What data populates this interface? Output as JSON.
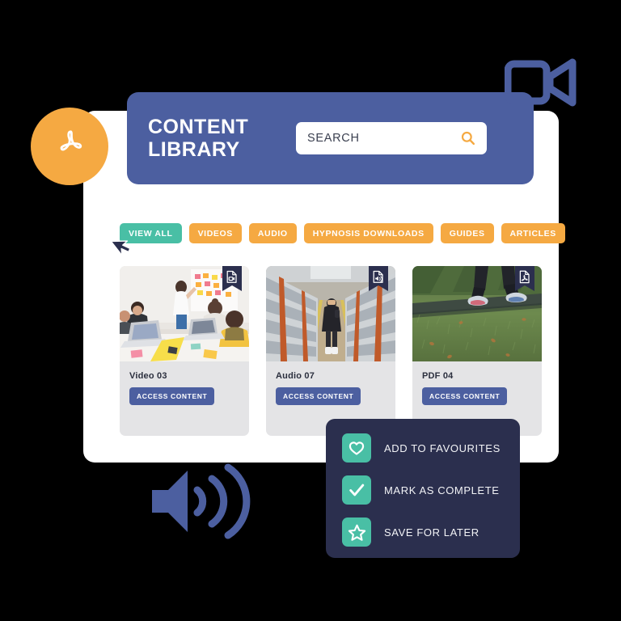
{
  "header": {
    "title": "CONTENT\nLIBRARY",
    "search": {
      "placeholder": "SEARCH",
      "value": "",
      "icon": "search-icon"
    },
    "background_color": "#4c5fa0"
  },
  "filters": {
    "active_index": 0,
    "active_color": "#49bfa5",
    "inactive_color": "#f5a942",
    "items": [
      {
        "label": "VIEW ALL",
        "active": true
      },
      {
        "label": "VIDEOS",
        "active": false
      },
      {
        "label": "AUDIO",
        "active": false
      },
      {
        "label": "HYPNOSIS DOWNLOADS",
        "active": false
      },
      {
        "label": "GUIDES",
        "active": false
      },
      {
        "label": "ARTICLES",
        "active": false
      }
    ]
  },
  "cards": {
    "button_label": "ACCESS CONTENT",
    "items": [
      {
        "title": "Video 03",
        "badge_icon": "video-file-icon",
        "thumb_alt": "team-meeting-sticky-notes-photo"
      },
      {
        "title": "Audio 07",
        "badge_icon": "audio-file-icon",
        "thumb_alt": "warehouse-aisle-worker-photo"
      },
      {
        "title": "PDF 04",
        "badge_icon": "pdf-file-icon",
        "thumb_alt": "runner-on-grass-photo"
      }
    ]
  },
  "action_panel": {
    "background_color": "#2b2f4e",
    "chip_color": "#49bfa5",
    "items": [
      {
        "label": "ADD TO FAVOURITES",
        "icon": "heart-icon"
      },
      {
        "label": "MARK AS COMPLETE",
        "icon": "check-icon"
      },
      {
        "label": "SAVE FOR LATER",
        "icon": "star-icon"
      }
    ]
  },
  "decorations": {
    "pdf_badge": {
      "icon": "adobe-pdf-icon",
      "color": "#f5a942"
    },
    "video_camera": {
      "icon": "video-camera-icon",
      "color": "#4c5fa0"
    },
    "speaker": {
      "icon": "speaker-waves-icon",
      "color": "#4c5fa0"
    },
    "cursor": {
      "icon": "mouse-cursor-icon",
      "color": "#2b2f4e"
    }
  }
}
